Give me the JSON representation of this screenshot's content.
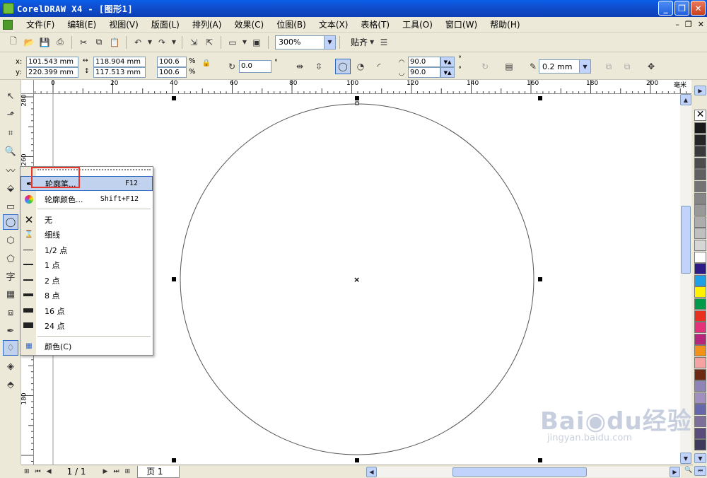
{
  "window": {
    "title": "CorelDRAW X4 - [图形1]",
    "min": "_",
    "max": "❐",
    "close": "✕"
  },
  "menu": [
    "文件(F)",
    "编辑(E)",
    "视图(V)",
    "版面(L)",
    "排列(A)",
    "效果(C)",
    "位图(B)",
    "文本(X)",
    "表格(T)",
    "工具(O)",
    "窗口(W)",
    "帮助(H)"
  ],
  "mdi": {
    "min": "–",
    "restore": "❐",
    "close": "✕"
  },
  "toolbar": {
    "zoom": "300%",
    "snap": "贴齐"
  },
  "property_bar": {
    "x_label": "x:",
    "x_value": "101.543 mm",
    "y_label": "y:",
    "y_value": "220.399 mm",
    "width": "118.904 mm",
    "height": "117.513 mm",
    "scale_x": "100.6",
    "scale_y": "100.6",
    "percent": "%",
    "rotation": "0.0",
    "degree": "°",
    "angle_start": "90.0",
    "angle_end": "90.0",
    "outline_width": "0.2 mm"
  },
  "ruler": {
    "h_ticks": [
      "0",
      "20",
      "40",
      "60",
      "80",
      "100",
      "120",
      "140",
      "160",
      "180",
      "200"
    ],
    "unit": "毫米",
    "v_ticks": [
      "280",
      "260",
      "180"
    ]
  },
  "flyout": {
    "items": [
      {
        "label": "轮廓笔...",
        "shortcut": "F12",
        "icon": "pen-nib-icon"
      },
      {
        "label": "轮廓颜色...",
        "shortcut": "Shift+F12",
        "icon": "color-wheel-icon"
      },
      {
        "label": "无",
        "shortcut": "",
        "icon": "x-icon"
      },
      {
        "label": "细线",
        "shortcut": "",
        "icon": "hairline-icon"
      },
      {
        "label": "1/2 点",
        "shortcut": ""
      },
      {
        "label": "1 点",
        "shortcut": ""
      },
      {
        "label": "2 点",
        "shortcut": ""
      },
      {
        "label": "8 点",
        "shortcut": ""
      },
      {
        "label": "16 点",
        "shortcut": ""
      },
      {
        "label": "24 点",
        "shortcut": ""
      },
      {
        "label": "颜色(C)",
        "shortcut": "",
        "icon": "color-docker-icon"
      }
    ]
  },
  "status": {
    "page_count": "1 / 1",
    "page_tab": "页 1"
  },
  "palette": [
    "#1a1a1a",
    "#262626",
    "#3a3a3a",
    "#4d4d4d",
    "#606060",
    "#737373",
    "#868686",
    "#999999",
    "#adadad",
    "#c0c0c0",
    "#d6d6d6",
    "#ffffff",
    "#2e1a86",
    "#1da0e6",
    "#fff200",
    "#009b48",
    "#e8321f",
    "#e5317a",
    "#b6277c",
    "#f29219",
    "#f5a3a0",
    "#6c2a12",
    "#8f84b8",
    "#a18fbf",
    "#6666aa",
    "#7d6f9a",
    "#5a4c7a",
    "#3f3a5c"
  ],
  "watermark": {
    "brand": "Bai◉du经验",
    "url": "jingyan.baidu.com"
  }
}
